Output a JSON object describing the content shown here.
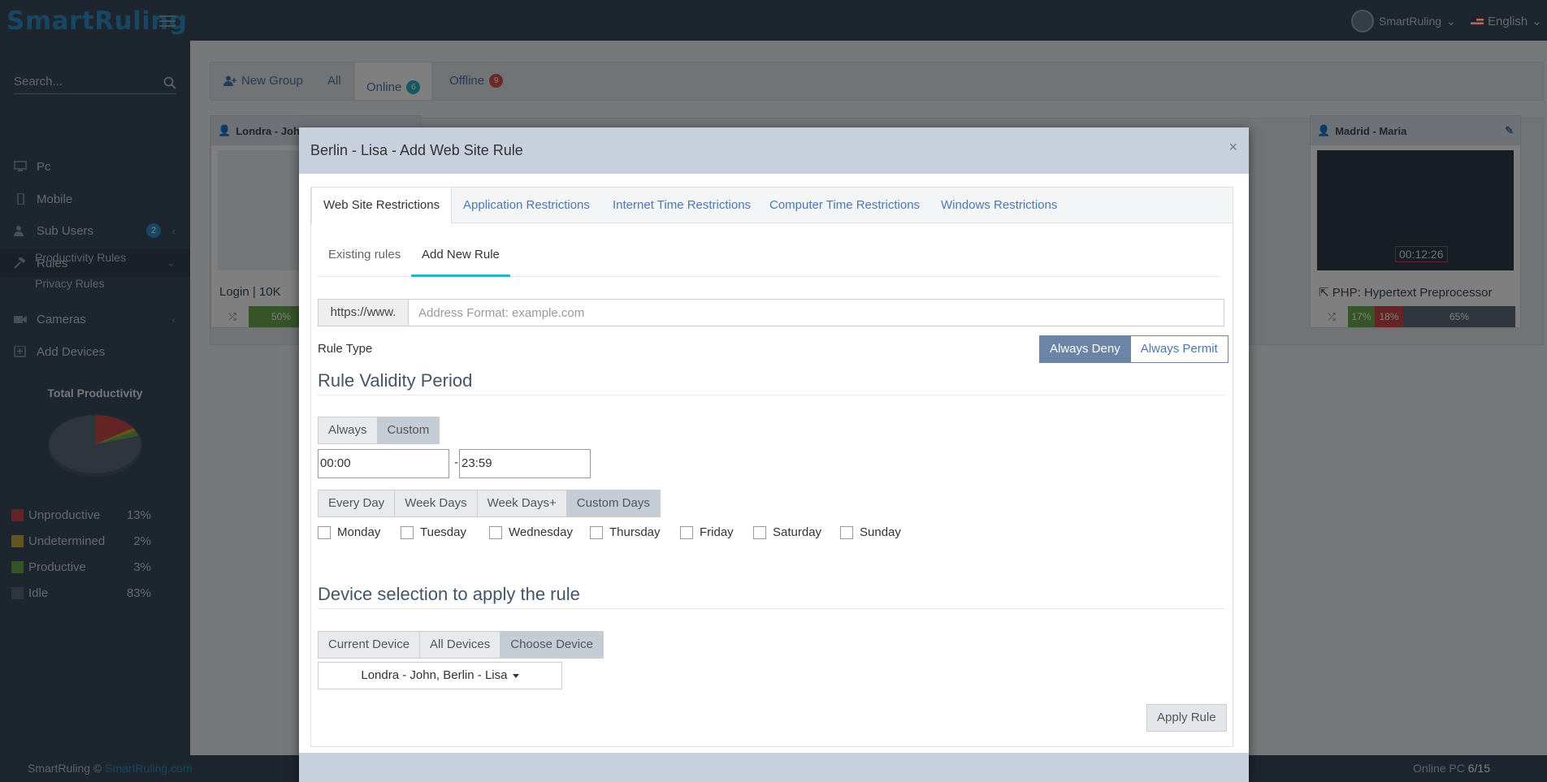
{
  "app": {
    "logo_text": "SmartRuling",
    "user_name": "SmartRuling",
    "language": "English"
  },
  "sidebar": {
    "search_placeholder": "Search...",
    "items": [
      {
        "label": "Pc"
      },
      {
        "label": "Mobile"
      },
      {
        "label": "Sub Users",
        "badge": "2"
      },
      {
        "label": "Rules"
      },
      {
        "label": "Cameras"
      },
      {
        "label": "Add Devices"
      }
    ],
    "rules_sub": [
      "Productivity Rules",
      "Privacy Rules"
    ],
    "productivity": {
      "title": "Total Productivity",
      "rows": [
        {
          "label": "Unproductive",
          "pct": "13%",
          "color": "#c9474b"
        },
        {
          "label": "Undetermined",
          "pct": "2%",
          "color": "#c9a83e"
        },
        {
          "label": "Productive",
          "pct": "3%",
          "color": "#6aa84f"
        },
        {
          "label": "Idle",
          "pct": "83%",
          "color": "#5e6b79"
        }
      ]
    }
  },
  "content": {
    "tabs": {
      "new_group": "New Group",
      "all": "All",
      "online": "Online",
      "online_count": "6",
      "offline": "Offline",
      "offline_count": "9"
    },
    "cards": [
      {
        "title": "Londra - John",
        "activity": "Login | 10K",
        "productive": "50%"
      },
      {
        "title": "Madrid - Maria",
        "activity": "PHP: Hypertext Preprocessor",
        "productive": "17%",
        "unproductive": "18%",
        "idle": "65%",
        "timer": "00:12:26"
      }
    ]
  },
  "footer": {
    "brand": "SmartRuling ©",
    "link": "SmartRuling.com",
    "online_label": "Online PC",
    "online_value": "6/15"
  },
  "modal": {
    "title": "Berlin - Lisa - Add Web Site Rule",
    "close": "×",
    "tabs": [
      "Web Site Restrictions",
      "Application Restrictions",
      "Internet Time Restrictions",
      "Computer Time Restrictions",
      "Windows Restrictions"
    ],
    "subtabs": [
      "Existing rules",
      "Add New Rule"
    ],
    "url_prefix": "https://www.",
    "url_placeholder": "Address Format: example.com",
    "rule_type_label": "Rule Type",
    "rule_type": {
      "deny": "Always Deny",
      "permit": "Always Permit",
      "selected": "Always Deny"
    },
    "validity_heading": "Rule Validity Period",
    "period": {
      "always": "Always",
      "custom": "Custom",
      "selected": "Custom"
    },
    "time_from": "00:00",
    "time_to": "23:59",
    "time_sep": "-",
    "day_modes": {
      "every": "Every Day",
      "week": "Week Days",
      "weekplus": "Week Days+",
      "custom": "Custom Days",
      "selected": "Custom Days"
    },
    "days": [
      "Monday",
      "Tuesday",
      "Wednesday",
      "Thursday",
      "Friday",
      "Saturday",
      "Sunday"
    ],
    "device_heading": "Device selection to apply the rule",
    "device_modes": {
      "current": "Current Device",
      "all": "All Devices",
      "choose": "Choose Device",
      "selected": "Choose Device"
    },
    "device_select": "Londra - John, Berlin - Lisa",
    "apply": "Apply Rule"
  }
}
